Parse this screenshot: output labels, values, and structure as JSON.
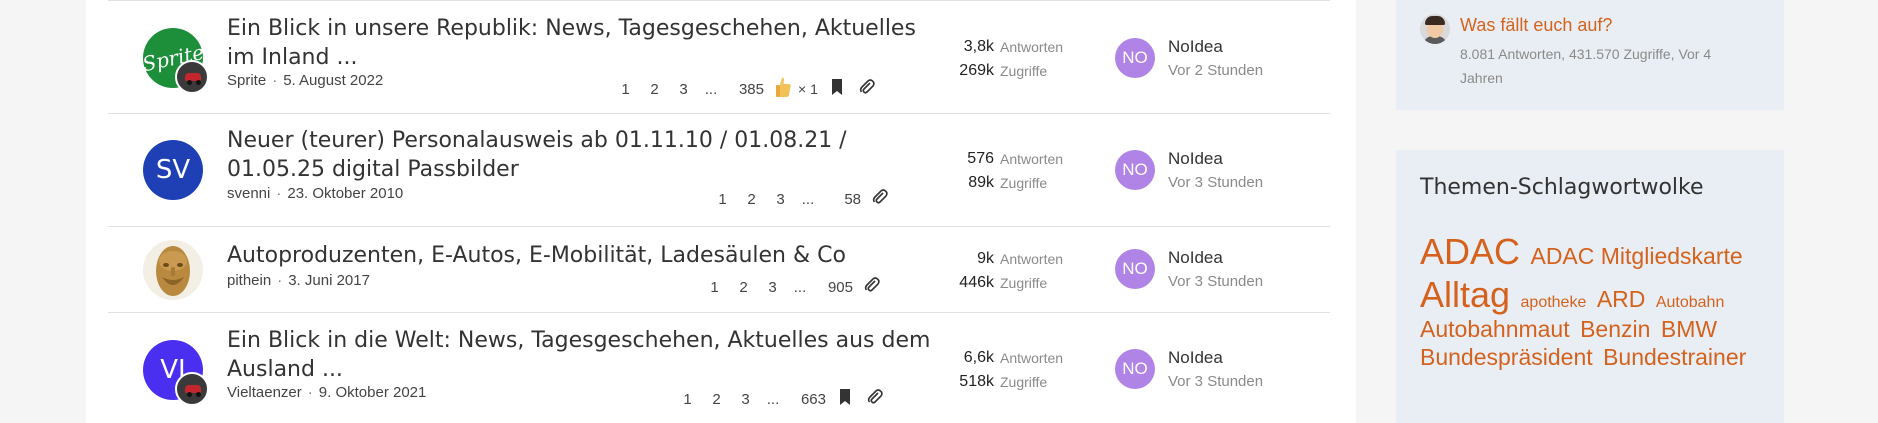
{
  "threads": [
    {
      "title": "Ein Blick in unsere Republik: News, Tagesgeschehen, Aktuelles im Inland ...",
      "author": "Sprite",
      "date": "5. August 2022",
      "avatar_initials": "",
      "avatar_label": "Sprite",
      "pages": [
        "1",
        "2",
        "3",
        "...",
        "385"
      ],
      "reaction": "× 1",
      "replies": "3,8k",
      "views": "269k",
      "last_user": "NoIdea",
      "last_initials": "NO",
      "last_time": "Vor 2 Stunden"
    },
    {
      "title": "Neuer (teurer) Personalausweis ab 01.11.10 / 01.08.21 / 01.05.25 digital Passbilder",
      "author": "svenni",
      "date": "23. Oktober 2010",
      "avatar_initials": "SV",
      "pages": [
        "1",
        "2",
        "3",
        "...",
        "58"
      ],
      "replies": "576",
      "views": "89k",
      "last_user": "NoIdea",
      "last_initials": "NO",
      "last_time": "Vor 3 Stunden"
    },
    {
      "title": "Autoproduzenten, E-Autos, E-Mobilität, Ladesäulen & Co",
      "author": "pithein",
      "date": "3. Juni 2017",
      "avatar_initials": "",
      "pages": [
        "1",
        "2",
        "3",
        "...",
        "905"
      ],
      "replies": "9k",
      "views": "446k",
      "last_user": "NoIdea",
      "last_initials": "NO",
      "last_time": "Vor 3 Stunden"
    },
    {
      "title": "Ein Blick in die Welt: News, Tagesgeschehen, Aktuelles aus dem Ausland ...",
      "author": "Vieltaenzer",
      "date": "9. Oktober 2021",
      "avatar_initials": "VI",
      "pages": [
        "1",
        "2",
        "3",
        "...",
        "663"
      ],
      "replies": "6,6k",
      "views": "518k",
      "last_user": "NoIdea",
      "last_initials": "NO",
      "last_time": "Vor 3 Stunden"
    }
  ],
  "labels": {
    "replies": "Antworten",
    "views": "Zugriffe"
  },
  "sidebar": {
    "thread_link": "Was fällt euch auf?",
    "thread_meta": "8.081 Antworten, 431.570 Zugriffe, Vor 4 Jahren",
    "cloud_title": "Themen-Schlagwortwolke",
    "tags": [
      {
        "label": "ADAC",
        "size": 36
      },
      {
        "label": "ADAC Mitgliedskarte",
        "size": 23
      },
      {
        "label": "Alltag",
        "size": 36
      },
      {
        "label": "apotheke",
        "size": 16
      },
      {
        "label": "ARD",
        "size": 23
      },
      {
        "label": "Autobahn",
        "size": 16
      },
      {
        "label": "Autobahnmaut",
        "size": 23
      },
      {
        "label": "Benzin",
        "size": 23
      },
      {
        "label": "BMW",
        "size": 23
      },
      {
        "label": "Bundespräsident",
        "size": 23
      },
      {
        "label": "Bundestrainer",
        "size": 23
      }
    ]
  },
  "colors": {
    "accent": "#d5621c",
    "last_avatar": "#b083e6",
    "sv_avatar": "#1e40b4",
    "vi_avatar": "#4a2ff0",
    "sidebar_bg": "#e9eef5"
  }
}
